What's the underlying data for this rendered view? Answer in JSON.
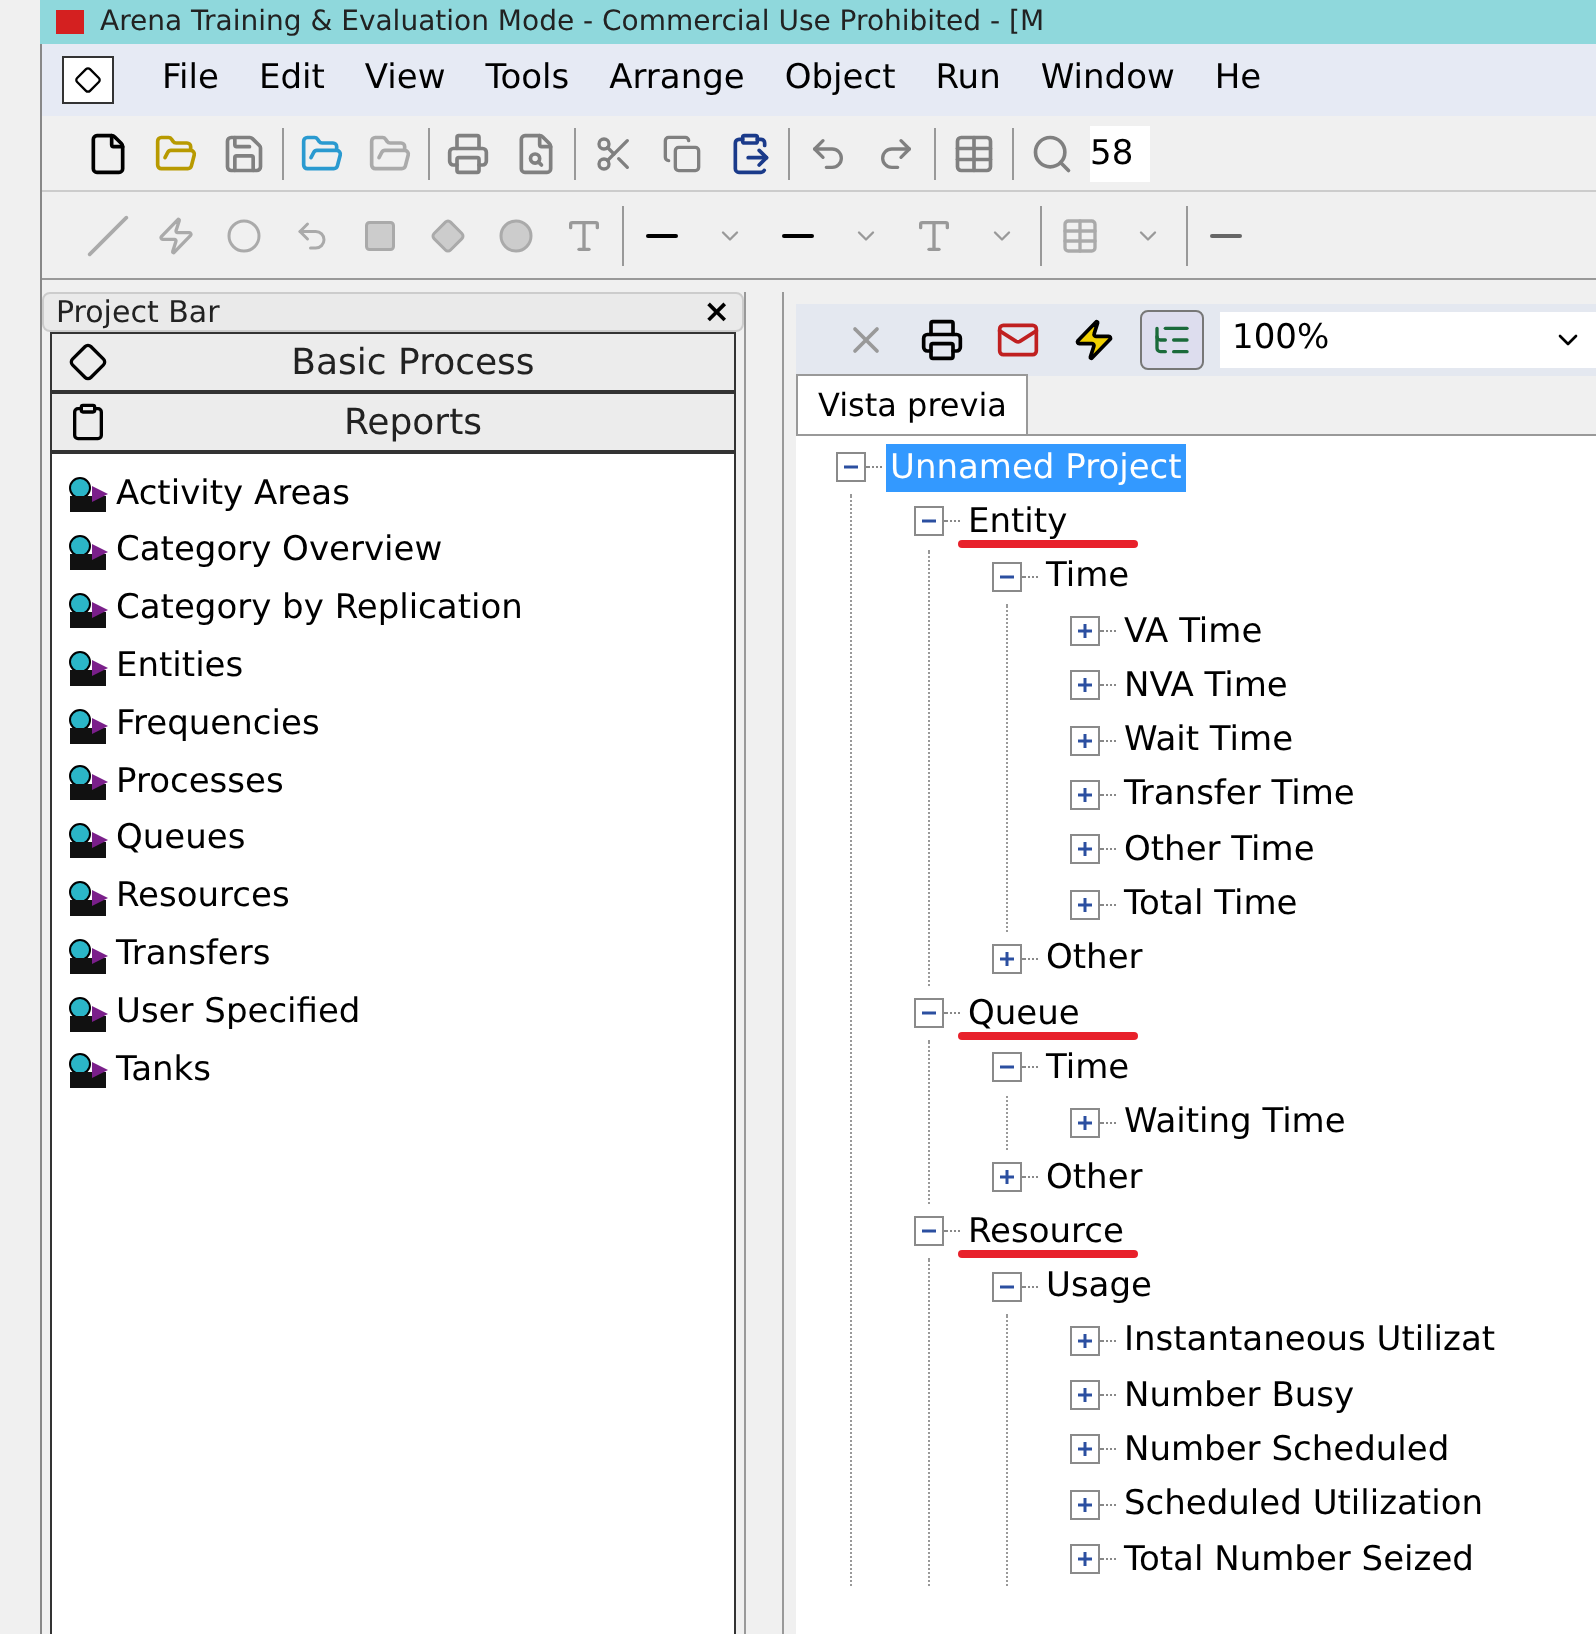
{
  "window": {
    "title": "Arena Training & Evaluation Mode - Commercial Use Prohibited - [M"
  },
  "menu": [
    "File",
    "Edit",
    "View",
    "Tools",
    "Arrange",
    "Object",
    "Run",
    "Window",
    "He"
  ],
  "toolbar": {
    "zoom_value": "58"
  },
  "project_bar": {
    "title": "Project Bar",
    "close": "×",
    "panels": [
      {
        "label": "Basic Process",
        "kind": "process"
      },
      {
        "label": "Reports",
        "kind": "reports"
      }
    ],
    "items": [
      "Activity Areas",
      "Category Overview",
      "Category by Replication",
      "Entities",
      "Frequencies",
      "Processes",
      "Queues",
      "Resources",
      "Transfers",
      "User Specified",
      "Tanks"
    ]
  },
  "report": {
    "zoom": "100%",
    "tabs": [
      {
        "label": "Vista previa",
        "selected": true
      }
    ],
    "tree": [
      {
        "label": "Unnamed Project",
        "expanded": true,
        "selected": true,
        "underlined": false,
        "children": [
          {
            "label": "Entity",
            "expanded": true,
            "selected": false,
            "underlined": true,
            "children": [
              {
                "label": "Time",
                "expanded": true,
                "selected": false,
                "underlined": false,
                "children": [
                  {
                    "label": "VA Time",
                    "expanded": false,
                    "selected": false,
                    "underlined": false
                  },
                  {
                    "label": "NVA Time",
                    "expanded": false,
                    "selected": false,
                    "underlined": false
                  },
                  {
                    "label": "Wait Time",
                    "expanded": false,
                    "selected": false,
                    "underlined": false
                  },
                  {
                    "label": "Transfer Time",
                    "expanded": false,
                    "selected": false,
                    "underlined": false
                  },
                  {
                    "label": "Other Time",
                    "expanded": false,
                    "selected": false,
                    "underlined": false
                  },
                  {
                    "label": "Total Time",
                    "expanded": false,
                    "selected": false,
                    "underlined": false
                  }
                ]
              },
              {
                "label": "Other",
                "expanded": false,
                "selected": false,
                "underlined": false
              }
            ]
          },
          {
            "label": "Queue",
            "expanded": true,
            "selected": false,
            "underlined": true,
            "children": [
              {
                "label": "Time",
                "expanded": true,
                "selected": false,
                "underlined": false,
                "children": [
                  {
                    "label": "Waiting Time",
                    "expanded": false,
                    "selected": false,
                    "underlined": false
                  }
                ]
              },
              {
                "label": "Other",
                "expanded": false,
                "selected": false,
                "underlined": false
              }
            ]
          },
          {
            "label": "Resource",
            "expanded": true,
            "selected": false,
            "underlined": true,
            "children": [
              {
                "label": "Usage",
                "expanded": true,
                "selected": false,
                "underlined": false,
                "children": [
                  {
                    "label": "Instantaneous Utilizat",
                    "expanded": false,
                    "selected": false,
                    "underlined": false
                  },
                  {
                    "label": "Number Busy",
                    "expanded": false,
                    "selected": false,
                    "underlined": false
                  },
                  {
                    "label": "Number Scheduled",
                    "expanded": false,
                    "selected": false,
                    "underlined": false
                  },
                  {
                    "label": "Scheduled Utilization",
                    "expanded": false,
                    "selected": false,
                    "underlined": false
                  },
                  {
                    "label": "Total Number Seized",
                    "expanded": false,
                    "selected": false,
                    "underlined": false
                  }
                ]
              }
            ]
          }
        ]
      }
    ]
  }
}
